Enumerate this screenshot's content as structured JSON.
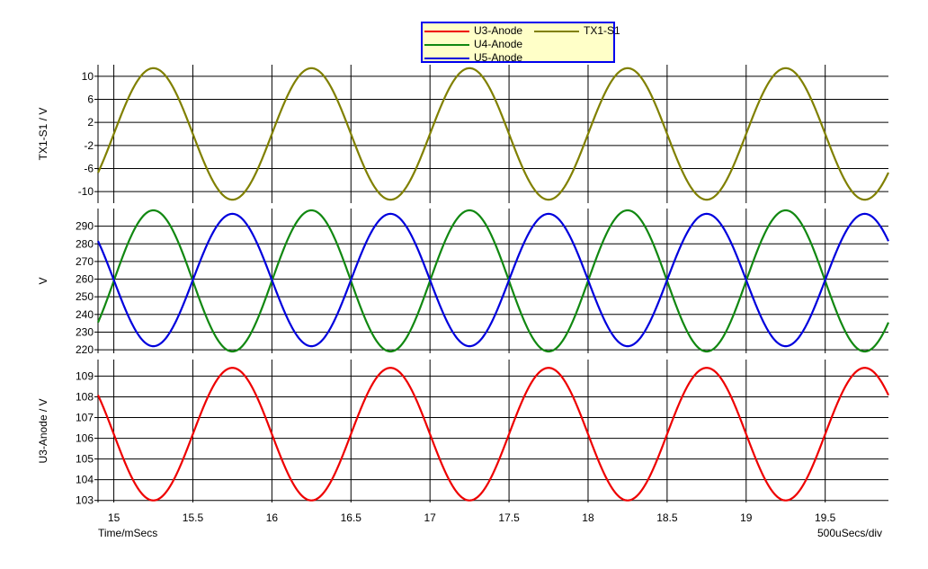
{
  "chart_data": {
    "type": "line",
    "x_axis": {
      "label": "Time/mSecs",
      "range": [
        14.9,
        19.9
      ],
      "tick_labels": [
        "15",
        "15.5",
        "16",
        "16.5",
        "17",
        "17.5",
        "18",
        "18.5",
        "19",
        "19.5"
      ],
      "division_label": "500uSecs/div"
    },
    "grid": true,
    "legend_placement": "top-center",
    "legend": [
      {
        "name": "U3-Anode",
        "color": "#ee0000"
      },
      {
        "name": "U4-Anode",
        "color": "#118811"
      },
      {
        "name": "U5-Anode",
        "color": "#0000dd"
      },
      {
        "name": "TX1-S1",
        "color": "#808000"
      }
    ],
    "panels": [
      {
        "ylabel": "TX1-S1 / V",
        "ylim": [
          -12,
          12
        ],
        "tick_labels": [
          "10",
          "6",
          "2",
          "-2",
          "-6",
          "-10"
        ],
        "series": [
          {
            "name": "TX1-S1",
            "color": "#808000",
            "wave": "sine",
            "offset": 0,
            "amplitude": 11.4,
            "period_ms": 1.0,
            "phase_reference_ms": 15.0,
            "phase": "rising-zero-crossing"
          }
        ]
      },
      {
        "ylabel": "V",
        "ylim": [
          218,
          300
        ],
        "tick_labels": [
          "290",
          "280",
          "270",
          "260",
          "250",
          "240",
          "230",
          "220"
        ],
        "series": [
          {
            "name": "U4-Anode",
            "color": "#118811",
            "wave": "sine",
            "offset": 259,
            "amplitude": 40,
            "period_ms": 1.0,
            "phase_reference_ms": 15.0,
            "phase": "rising-center-crossing"
          },
          {
            "name": "U5-Anode",
            "color": "#0000dd",
            "wave": "sine",
            "offset": 259.5,
            "amplitude": 37.5,
            "period_ms": 1.0,
            "phase_reference_ms": 15.0,
            "phase": "falling-center-crossing"
          }
        ]
      },
      {
        "ylabel": "U3-Anode / V",
        "ylim": [
          102.9,
          109.8
        ],
        "tick_labels": [
          "109",
          "108",
          "107",
          "106",
          "105",
          "104",
          "103"
        ],
        "series": [
          {
            "name": "U3-Anode",
            "color": "#ee0000",
            "wave": "sine",
            "offset": 106.2,
            "amplitude": 3.2,
            "period_ms": 1.0,
            "phase_reference_ms": 15.0,
            "phase": "falling-center-crossing"
          }
        ]
      }
    ]
  }
}
